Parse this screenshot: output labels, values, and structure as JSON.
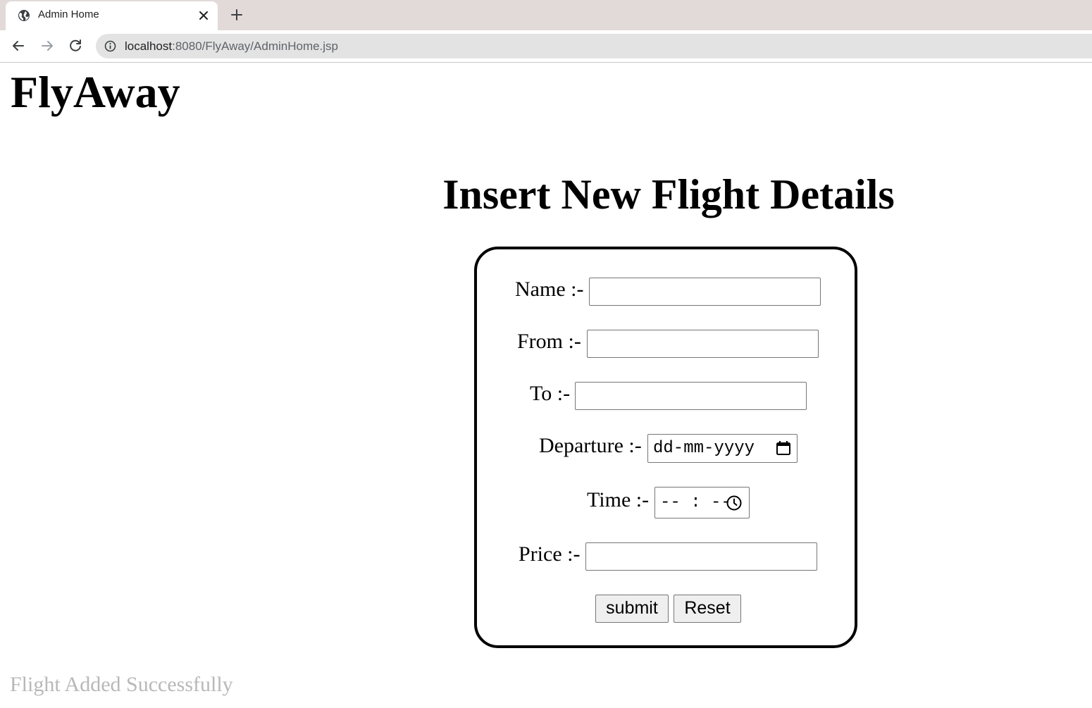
{
  "browser": {
    "tab_title": "Admin Home",
    "url_host": "localhost",
    "url_path": ":8080/FlyAway/AdminHome.jsp"
  },
  "page": {
    "brand": "FlyAway",
    "heading": "Insert New Flight Details",
    "status_message": "Flight Added Successfully"
  },
  "form": {
    "name_label": "Name :-",
    "name_value": "",
    "from_label": "From :-",
    "from_value": "",
    "to_label": "To :-",
    "to_value": "",
    "departure_label": "Departure :-",
    "departure_placeholder": "dd-mm-yyyy",
    "time_label": "Time :-",
    "time_placeholder": "-- : --",
    "price_label": "Price :-",
    "price_value": "",
    "submit_label": "submit",
    "reset_label": "Reset"
  },
  "icons": {
    "favicon": "globe-icon",
    "tab_close": "close-icon",
    "new_tab": "plus-icon",
    "back": "arrow-left-icon",
    "forward": "arrow-right-icon",
    "reload": "reload-icon",
    "site_info": "info-icon",
    "calendar": "calendar-icon",
    "clock": "clock-icon"
  },
  "colors": {
    "tabbar": "#e2dad8",
    "omnibox": "#e3e3e3",
    "status_text": "#b8b8b8",
    "form_border": "#000000"
  }
}
